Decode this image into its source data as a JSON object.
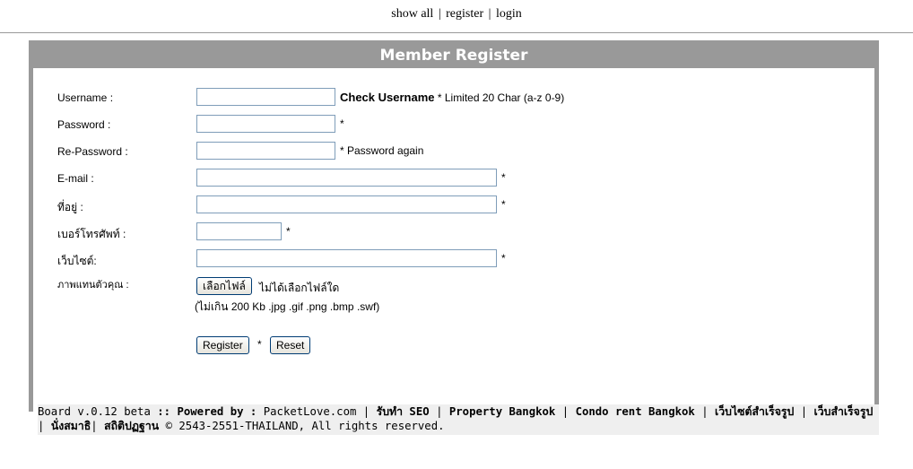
{
  "topnav": {
    "show_all": "show all",
    "sep": "|",
    "register": "register",
    "login": "login"
  },
  "form": {
    "title": "Member Register",
    "fields": [
      {
        "label": "Username :",
        "value": "",
        "note_strong": "Check Username",
        "note": "* Limited 20 Char (a-z 0-9)"
      },
      {
        "label": "Password :",
        "value": "",
        "note": "*"
      },
      {
        "label": "Re-Password :",
        "value": "",
        "note": "* Password again"
      },
      {
        "label": "E-mail :",
        "value": "",
        "note": "*"
      },
      {
        "label": "ที่อยู่ :",
        "value": "",
        "note": "*"
      },
      {
        "label": "เบอร์โทรศัพท์ :",
        "value": "",
        "note": "*"
      },
      {
        "label": "เว็บไซต์:",
        "value": "",
        "note": "*"
      }
    ],
    "avatar": {
      "label": "ภาพแทนตัวคุณ :",
      "choose_button": "เลือกไฟล์",
      "no_file": "ไม่ได้เลือกไฟล์ใด",
      "hint": "(ไม่เกิน 200 Kb .jpg .gif .png .bmp .swf)"
    },
    "register_button": "Register",
    "star": "*",
    "reset_button": "Reset"
  },
  "footer": {
    "board": "Board v.0.12 beta",
    "powered": ":: Powered by :",
    "packetlove": "PacketLove.com",
    "sep": "|",
    "links": [
      "รับทำ SEO",
      "Property Bangkok",
      "Condo rent Bangkok",
      "เว็บไซต์สำเร็จรูป",
      "เว็บสำเร็จรูป",
      "นั่งสมาธิ",
      "สถิติปฏฐาน"
    ],
    "copyright": "© 2543-2551-THAILAND, All rights reserved."
  },
  "colors": {
    "frame": "#999999",
    "footer_bg": "#efefef",
    "input_border": "#7f9db9"
  }
}
